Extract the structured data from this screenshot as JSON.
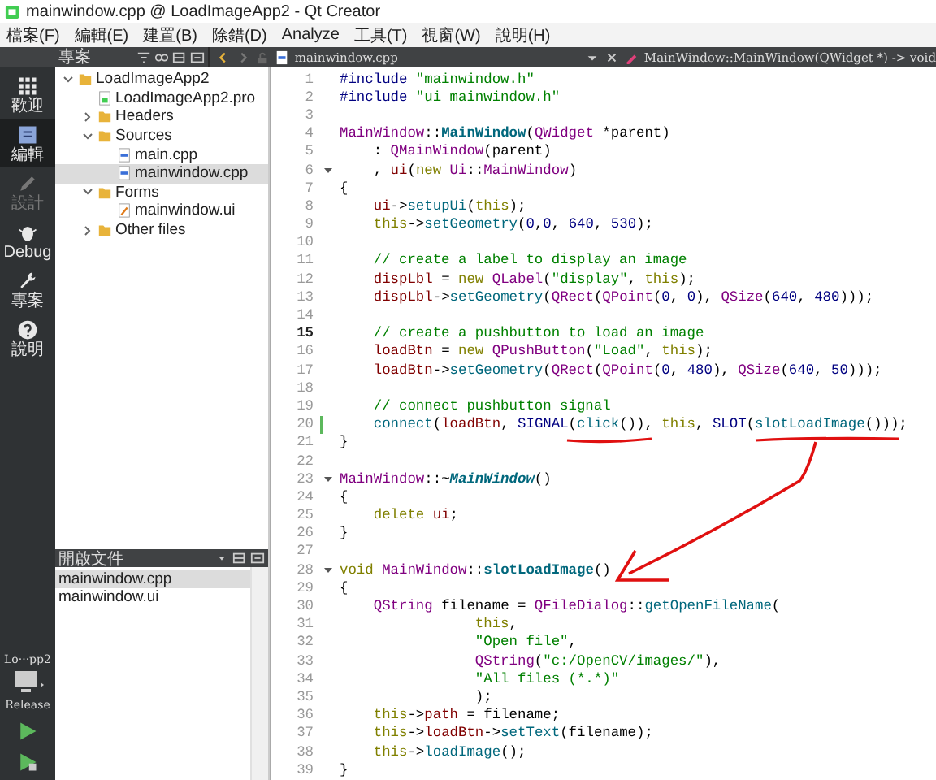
{
  "window": {
    "title": "mainwindow.cpp @ LoadImageApp2 - Qt Creator"
  },
  "menu": [
    "檔案(F)",
    "編輯(E)",
    "建置(B)",
    "除錯(D)",
    "Analyze",
    "工具(T)",
    "視窗(W)",
    "說明(H)"
  ],
  "modes": [
    {
      "label": "歡迎",
      "kind": "grid",
      "selected": false,
      "disabled": false
    },
    {
      "label": "編輯",
      "kind": "edit",
      "selected": true,
      "disabled": false
    },
    {
      "label": "設計",
      "kind": "pen",
      "selected": false,
      "disabled": true
    },
    {
      "label": "Debug",
      "kind": "bug",
      "selected": false,
      "disabled": false
    },
    {
      "label": "專案",
      "kind": "wrench",
      "selected": false,
      "disabled": false
    },
    {
      "label": "說明",
      "kind": "help",
      "selected": false,
      "disabled": false
    }
  ],
  "target": {
    "project": "Lo···pp2",
    "config": "Release"
  },
  "project_panel": {
    "title": "專案",
    "tree": [
      {
        "label": "LoadImageApp2",
        "kind": "project",
        "expanded": true,
        "selected": false,
        "children": [
          {
            "label": "LoadImageApp2.pro",
            "kind": "profile",
            "selected": false
          },
          {
            "label": "Headers",
            "kind": "folder",
            "expanded": false,
            "selected": false
          },
          {
            "label": "Sources",
            "kind": "folder",
            "expanded": true,
            "selected": false,
            "children": [
              {
                "label": "main.cpp",
                "kind": "source",
                "selected": false
              },
              {
                "label": "mainwindow.cpp",
                "kind": "source",
                "selected": true
              }
            ]
          },
          {
            "label": "Forms",
            "kind": "folder",
            "expanded": true,
            "selected": false,
            "children": [
              {
                "label": "mainwindow.ui",
                "kind": "form",
                "selected": false
              }
            ]
          },
          {
            "label": "Other files",
            "kind": "folder",
            "expanded": false,
            "selected": false
          }
        ]
      }
    ]
  },
  "open_documents": {
    "title": "開啟文件",
    "items": [
      {
        "label": "mainwindow.cpp",
        "selected": true
      },
      {
        "label": "mainwindow.ui",
        "selected": false
      }
    ]
  },
  "editor": {
    "file": "mainwindow.cpp",
    "symbol": "MainWindow::MainWindow(QWidget *) -> void",
    "lines": [
      {
        "num": "1",
        "fold": false,
        "current": false,
        "modified": false,
        "tokens": [
          {
            "kind": "pp",
            "text": "#include "
          },
          {
            "kind": "str",
            "text": "\"mainwindow.h\""
          }
        ]
      },
      {
        "num": "2",
        "fold": false,
        "current": false,
        "modified": false,
        "tokens": [
          {
            "kind": "pp",
            "text": "#include "
          },
          {
            "kind": "str",
            "text": "\"ui_mainwindow.h\""
          }
        ]
      },
      {
        "num": "3",
        "fold": false,
        "current": false,
        "modified": false
      },
      {
        "num": "4",
        "fold": false,
        "current": false,
        "modified": false,
        "tokens": [
          {
            "kind": "type",
            "text": "MainWindow"
          },
          {
            "kind": "pl",
            "text": "::"
          },
          {
            "kind": "fnb",
            "text": "MainWindow"
          },
          {
            "kind": "pl",
            "text": "("
          },
          {
            "kind": "type",
            "text": "QWidget"
          },
          {
            "kind": "pl",
            "text": " *parent)"
          }
        ]
      },
      {
        "num": "5",
        "fold": false,
        "current": false,
        "modified": false,
        "tokens": [
          {
            "kind": "pl",
            "text": "    : "
          },
          {
            "kind": "type",
            "text": "QMainWindow"
          },
          {
            "kind": "pl",
            "text": "(parent)"
          }
        ]
      },
      {
        "num": "6",
        "fold": true,
        "current": false,
        "modified": false,
        "tokens": [
          {
            "kind": "pl",
            "text": "    , "
          },
          {
            "kind": "mem",
            "text": "ui"
          },
          {
            "kind": "pl",
            "text": "("
          },
          {
            "kind": "kw",
            "text": "new "
          },
          {
            "kind": "type",
            "text": "Ui"
          },
          {
            "kind": "pl",
            "text": "::"
          },
          {
            "kind": "type",
            "text": "MainWindow"
          },
          {
            "kind": "pl",
            "text": ")"
          }
        ]
      },
      {
        "num": "7",
        "fold": false,
        "current": false,
        "modified": false,
        "tokens": [
          {
            "kind": "pl",
            "text": "{"
          }
        ]
      },
      {
        "num": "8",
        "fold": false,
        "current": false,
        "modified": false,
        "tokens": [
          {
            "kind": "mem",
            "text": "    ui"
          },
          {
            "kind": "pl",
            "text": "->"
          },
          {
            "kind": "fn",
            "text": "setupUi"
          },
          {
            "kind": "pl",
            "text": "("
          },
          {
            "kind": "kw",
            "text": "this"
          },
          {
            "kind": "pl",
            "text": ");"
          }
        ]
      },
      {
        "num": "9",
        "fold": false,
        "current": false,
        "modified": false,
        "tokens": [
          {
            "kind": "kw",
            "text": "    this"
          },
          {
            "kind": "pl",
            "text": "->"
          },
          {
            "kind": "fn",
            "text": "setGeometry"
          },
          {
            "kind": "pl",
            "text": "("
          },
          {
            "kind": "num",
            "text": "0"
          },
          {
            "kind": "pl",
            "text": ","
          },
          {
            "kind": "num",
            "text": "0"
          },
          {
            "kind": "pl",
            "text": ", "
          },
          {
            "kind": "num",
            "text": "640"
          },
          {
            "kind": "pl",
            "text": ", "
          },
          {
            "kind": "num",
            "text": "530"
          },
          {
            "kind": "pl",
            "text": ");"
          }
        ]
      },
      {
        "num": "10",
        "fold": false,
        "current": false,
        "modified": false
      },
      {
        "num": "11",
        "fold": false,
        "current": false,
        "modified": false,
        "tokens": [
          {
            "kind": "cm",
            "text": "    // create a label to display an image"
          }
        ]
      },
      {
        "num": "12",
        "fold": false,
        "current": false,
        "modified": false,
        "tokens": [
          {
            "kind": "mem",
            "text": "    dispLbl"
          },
          {
            "kind": "pl",
            "text": " = "
          },
          {
            "kind": "kw",
            "text": "new "
          },
          {
            "kind": "type",
            "text": "QLabel"
          },
          {
            "kind": "pl",
            "text": "("
          },
          {
            "kind": "str",
            "text": "\"display\""
          },
          {
            "kind": "pl",
            "text": ", "
          },
          {
            "kind": "kw",
            "text": "this"
          },
          {
            "kind": "pl",
            "text": ");"
          }
        ]
      },
      {
        "num": "13",
        "fold": false,
        "current": false,
        "modified": false,
        "tokens": [
          {
            "kind": "mem",
            "text": "    dispLbl"
          },
          {
            "kind": "pl",
            "text": "->"
          },
          {
            "kind": "fn",
            "text": "setGeometry"
          },
          {
            "kind": "pl",
            "text": "("
          },
          {
            "kind": "type",
            "text": "QRect"
          },
          {
            "kind": "pl",
            "text": "("
          },
          {
            "kind": "type",
            "text": "QPoint"
          },
          {
            "kind": "pl",
            "text": "("
          },
          {
            "kind": "num",
            "text": "0"
          },
          {
            "kind": "pl",
            "text": ", "
          },
          {
            "kind": "num",
            "text": "0"
          },
          {
            "kind": "pl",
            "text": "), "
          },
          {
            "kind": "type",
            "text": "QSize"
          },
          {
            "kind": "pl",
            "text": "("
          },
          {
            "kind": "num",
            "text": "640"
          },
          {
            "kind": "pl",
            "text": ", "
          },
          {
            "kind": "num",
            "text": "480"
          },
          {
            "kind": "pl",
            "text": ")));"
          }
        ]
      },
      {
        "num": "14",
        "fold": false,
        "current": false,
        "modified": false
      },
      {
        "num": "15",
        "fold": false,
        "current": true,
        "modified": false,
        "tokens": [
          {
            "kind": "cm",
            "text": "    // create a pushbutton to load an image"
          }
        ]
      },
      {
        "num": "16",
        "fold": false,
        "current": false,
        "modified": false,
        "tokens": [
          {
            "kind": "mem",
            "text": "    loadBtn"
          },
          {
            "kind": "pl",
            "text": " = "
          },
          {
            "kind": "kw",
            "text": "new "
          },
          {
            "kind": "type",
            "text": "QPushButton"
          },
          {
            "kind": "pl",
            "text": "("
          },
          {
            "kind": "str",
            "text": "\"Load\""
          },
          {
            "kind": "pl",
            "text": ", "
          },
          {
            "kind": "kw",
            "text": "this"
          },
          {
            "kind": "pl",
            "text": ");"
          }
        ]
      },
      {
        "num": "17",
        "fold": false,
        "current": false,
        "modified": false,
        "tokens": [
          {
            "kind": "mem",
            "text": "    loadBtn"
          },
          {
            "kind": "pl",
            "text": "->"
          },
          {
            "kind": "fn",
            "text": "setGeometry"
          },
          {
            "kind": "pl",
            "text": "("
          },
          {
            "kind": "type",
            "text": "QRect"
          },
          {
            "kind": "pl",
            "text": "("
          },
          {
            "kind": "type",
            "text": "QPoint"
          },
          {
            "kind": "pl",
            "text": "("
          },
          {
            "kind": "num",
            "text": "0"
          },
          {
            "kind": "pl",
            "text": ", "
          },
          {
            "kind": "num",
            "text": "480"
          },
          {
            "kind": "pl",
            "text": "), "
          },
          {
            "kind": "type",
            "text": "QSize"
          },
          {
            "kind": "pl",
            "text": "("
          },
          {
            "kind": "num",
            "text": "640"
          },
          {
            "kind": "pl",
            "text": ", "
          },
          {
            "kind": "num",
            "text": "50"
          },
          {
            "kind": "pl",
            "text": ")));"
          }
        ]
      },
      {
        "num": "18",
        "fold": false,
        "current": false,
        "modified": false
      },
      {
        "num": "19",
        "fold": false,
        "current": false,
        "modified": false,
        "tokens": [
          {
            "kind": "cm",
            "text": "    // connect pushbutton signal"
          }
        ]
      },
      {
        "num": "20",
        "fold": false,
        "current": false,
        "modified": true,
        "tokens": [
          {
            "kind": "fn",
            "text": "    connect"
          },
          {
            "kind": "pl",
            "text": "("
          },
          {
            "kind": "mem",
            "text": "loadBtn"
          },
          {
            "kind": "pl",
            "text": ", "
          },
          {
            "kind": "pp",
            "text": "SIGNAL"
          },
          {
            "kind": "pl",
            "text": "("
          },
          {
            "kind": "fn",
            "text": "click"
          },
          {
            "kind": "pl",
            "text": "()), "
          },
          {
            "kind": "kw",
            "text": "this"
          },
          {
            "kind": "pl",
            "text": ", "
          },
          {
            "kind": "pp",
            "text": "SLOT"
          },
          {
            "kind": "pl",
            "text": "("
          },
          {
            "kind": "fn",
            "text": "slotLoadImage"
          },
          {
            "kind": "pl",
            "text": "()));"
          }
        ]
      },
      {
        "num": "21",
        "fold": false,
        "current": false,
        "modified": false,
        "tokens": [
          {
            "kind": "pl",
            "text": "}"
          }
        ]
      },
      {
        "num": "22",
        "fold": false,
        "current": false,
        "modified": false
      },
      {
        "num": "23",
        "fold": true,
        "current": false,
        "modified": false,
        "tokens": [
          {
            "kind": "type",
            "text": "MainWindow"
          },
          {
            "kind": "pl",
            "text": "::~"
          },
          {
            "kind": "fni",
            "text": "MainWindow"
          },
          {
            "kind": "pl",
            "text": "()"
          }
        ]
      },
      {
        "num": "24",
        "fold": false,
        "current": false,
        "modified": false,
        "tokens": [
          {
            "kind": "pl",
            "text": "{"
          }
        ]
      },
      {
        "num": "25",
        "fold": false,
        "current": false,
        "modified": false,
        "tokens": [
          {
            "kind": "kw",
            "text": "    delete "
          },
          {
            "kind": "mem",
            "text": "ui"
          },
          {
            "kind": "pl",
            "text": ";"
          }
        ]
      },
      {
        "num": "26",
        "fold": false,
        "current": false,
        "modified": false,
        "tokens": [
          {
            "kind": "pl",
            "text": "}"
          }
        ]
      },
      {
        "num": "27",
        "fold": false,
        "current": false,
        "modified": false
      },
      {
        "num": "28",
        "fold": true,
        "current": false,
        "modified": false,
        "tokens": [
          {
            "kind": "kw",
            "text": "void "
          },
          {
            "kind": "type",
            "text": "MainWindow"
          },
          {
            "kind": "pl",
            "text": "::"
          },
          {
            "kind": "fnb",
            "text": "slotLoadImage"
          },
          {
            "kind": "pl",
            "text": "()"
          }
        ]
      },
      {
        "num": "29",
        "fold": false,
        "current": false,
        "modified": false,
        "tokens": [
          {
            "kind": "pl",
            "text": "{"
          }
        ]
      },
      {
        "num": "30",
        "fold": false,
        "current": false,
        "modified": false,
        "tokens": [
          {
            "kind": "type",
            "text": "    QString"
          },
          {
            "kind": "pl",
            "text": " filename = "
          },
          {
            "kind": "type",
            "text": "QFileDialog"
          },
          {
            "kind": "pl",
            "text": "::"
          },
          {
            "kind": "fn",
            "text": "getOpenFileName"
          },
          {
            "kind": "pl",
            "text": "("
          }
        ]
      },
      {
        "num": "31",
        "fold": false,
        "current": false,
        "modified": false,
        "tokens": [
          {
            "kind": "kw",
            "text": "                this"
          },
          {
            "kind": "pl",
            "text": ","
          }
        ]
      },
      {
        "num": "32",
        "fold": false,
        "current": false,
        "modified": false,
        "tokens": [
          {
            "kind": "str",
            "text": "                \"Open file\""
          },
          {
            "kind": "pl",
            "text": ","
          }
        ]
      },
      {
        "num": "33",
        "fold": false,
        "current": false,
        "modified": false,
        "tokens": [
          {
            "kind": "type",
            "text": "                QString"
          },
          {
            "kind": "pl",
            "text": "("
          },
          {
            "kind": "str",
            "text": "\"c:/OpenCV/images/\""
          },
          {
            "kind": "pl",
            "text": "),"
          }
        ]
      },
      {
        "num": "34",
        "fold": false,
        "current": false,
        "modified": false,
        "tokens": [
          {
            "kind": "str",
            "text": "                \"All files (*.*)\""
          }
        ]
      },
      {
        "num": "35",
        "fold": false,
        "current": false,
        "modified": false,
        "tokens": [
          {
            "kind": "pl",
            "text": "                );"
          }
        ]
      },
      {
        "num": "36",
        "fold": false,
        "current": false,
        "modified": false,
        "tokens": [
          {
            "kind": "kw",
            "text": "    this"
          },
          {
            "kind": "pl",
            "text": "->"
          },
          {
            "kind": "mem",
            "text": "path"
          },
          {
            "kind": "pl",
            "text": " = filename;"
          }
        ]
      },
      {
        "num": "37",
        "fold": false,
        "current": false,
        "modified": false,
        "tokens": [
          {
            "kind": "kw",
            "text": "    this"
          },
          {
            "kind": "pl",
            "text": "->"
          },
          {
            "kind": "mem",
            "text": "loadBtn"
          },
          {
            "kind": "pl",
            "text": "->"
          },
          {
            "kind": "fn",
            "text": "setText"
          },
          {
            "kind": "pl",
            "text": "(filename);"
          }
        ]
      },
      {
        "num": "38",
        "fold": false,
        "current": false,
        "modified": false,
        "tokens": [
          {
            "kind": "kw",
            "text": "    this"
          },
          {
            "kind": "pl",
            "text": "->"
          },
          {
            "kind": "fn",
            "text": "loadImage"
          },
          {
            "kind": "pl",
            "text": "();"
          }
        ]
      },
      {
        "num": "39",
        "fold": false,
        "current": false,
        "modified": false,
        "tokens": [
          {
            "kind": "pl",
            "text": "}"
          }
        ]
      }
    ]
  }
}
